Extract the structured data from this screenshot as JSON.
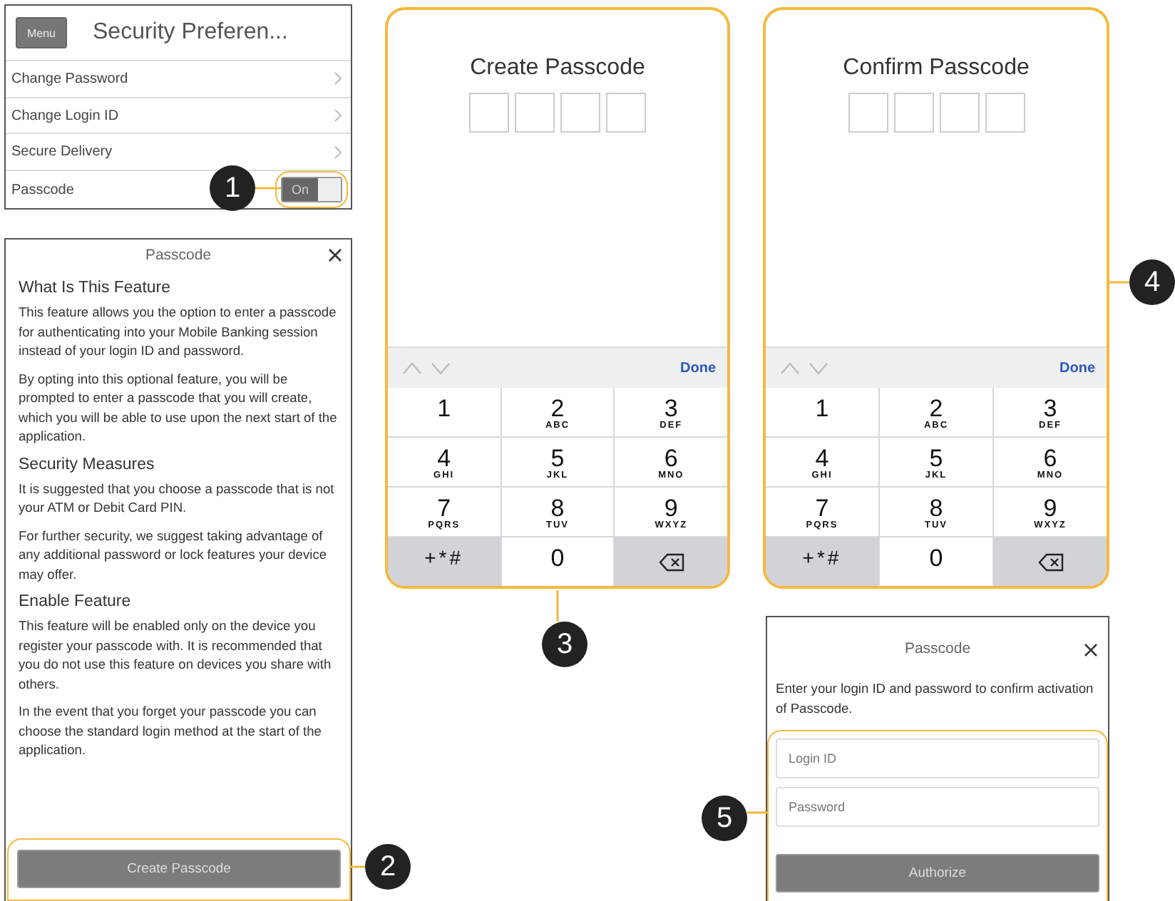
{
  "settings_screen": {
    "menu_button": "Menu",
    "title": "Security Preferen...",
    "rows": [
      {
        "label": "Change Password",
        "kind": "link"
      },
      {
        "label": "Change Login ID",
        "kind": "link"
      },
      {
        "label": "Secure Delivery",
        "kind": "link"
      },
      {
        "label": "Passcode",
        "kind": "toggle",
        "on": true,
        "toggle_label": "On"
      }
    ]
  },
  "info_dialog": {
    "title": "Passcode",
    "sections": [
      {
        "heading": "What Is This Feature",
        "paragraphs": [
          "This feature allows you the option to enter a passcode for authenticating into your Mobile Banking session instead of your login ID and password.",
          "By opting into this optional feature, you will be prompted to enter a passcode that you will create, which you will be able to use upon the next start of the application."
        ]
      },
      {
        "heading": "Security Measures",
        "paragraphs": [
          "It is suggested that you choose a passcode that is not your ATM or Debit Card PIN.",
          "For further security, we suggest taking advantage of any additional password or lock features your device may offer."
        ]
      },
      {
        "heading": "Enable Feature",
        "paragraphs": [
          "This feature will be enabled only on the device you register your passcode with. It is recommended that you do not use this feature on devices you share with others.",
          "In the event that you forget your passcode you can choose the standard login method at the start of the application."
        ]
      }
    ],
    "button": "Create Passcode"
  },
  "passcode_screens": [
    {
      "title": "Create Passcode",
      "boxes": [
        {
          "filled": false
        },
        {
          "filled": false
        },
        {
          "filled": false
        },
        {
          "filled": false
        }
      ],
      "keyboard": {
        "done": "Done",
        "keys": [
          {
            "kind": "digit",
            "digit": "1"
          },
          {
            "kind": "digit",
            "digit": "2",
            "letters": "ABC"
          },
          {
            "kind": "digit",
            "digit": "3",
            "letters": "DEF"
          },
          {
            "kind": "digit",
            "digit": "4",
            "letters": "GHI"
          },
          {
            "kind": "digit",
            "digit": "5",
            "letters": "JKL"
          },
          {
            "kind": "digit",
            "digit": "6",
            "letters": "MNO"
          },
          {
            "kind": "digit",
            "digit": "7",
            "letters": "PQRS"
          },
          {
            "kind": "digit",
            "digit": "8",
            "letters": "TUV"
          },
          {
            "kind": "digit",
            "digit": "9",
            "letters": "WXYZ"
          },
          {
            "kind": "symbols",
            "digit": "+*#"
          },
          {
            "kind": "digit",
            "digit": "0"
          },
          {
            "kind": "delete"
          }
        ]
      }
    },
    {
      "title": "Confirm Passcode",
      "boxes": [
        {
          "filled": false
        },
        {
          "filled": false
        },
        {
          "filled": false
        },
        {
          "filled": false
        }
      ],
      "keyboard": {
        "done": "Done",
        "keys": [
          {
            "kind": "digit",
            "digit": "1"
          },
          {
            "kind": "digit",
            "digit": "2",
            "letters": "ABC"
          },
          {
            "kind": "digit",
            "digit": "3",
            "letters": "DEF"
          },
          {
            "kind": "digit",
            "digit": "4",
            "letters": "GHI"
          },
          {
            "kind": "digit",
            "digit": "5",
            "letters": "JKL"
          },
          {
            "kind": "digit",
            "digit": "6",
            "letters": "MNO"
          },
          {
            "kind": "digit",
            "digit": "7",
            "letters": "PQRS"
          },
          {
            "kind": "digit",
            "digit": "8",
            "letters": "TUV"
          },
          {
            "kind": "digit",
            "digit": "9",
            "letters": "WXYZ"
          },
          {
            "kind": "symbols",
            "digit": "+*#"
          },
          {
            "kind": "digit",
            "digit": "0"
          },
          {
            "kind": "delete"
          }
        ]
      }
    }
  ],
  "confirm_dialog": {
    "title": "Passcode",
    "message": "Enter your login ID and password to confirm activation of Passcode.",
    "fields": [
      {
        "placeholder": "Login ID"
      },
      {
        "placeholder": "Password"
      }
    ],
    "button": "Authorize"
  },
  "callouts": [
    {
      "number": "1"
    },
    {
      "number": "2"
    },
    {
      "number": "3"
    },
    {
      "number": "4"
    },
    {
      "number": "5"
    }
  ]
}
